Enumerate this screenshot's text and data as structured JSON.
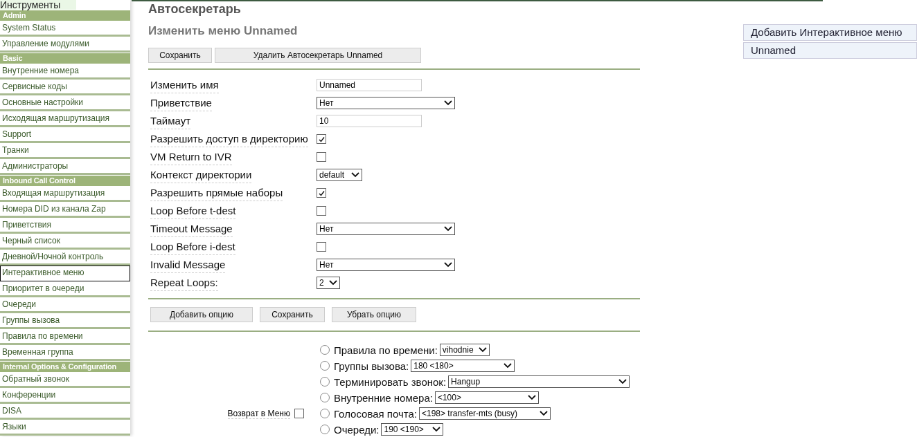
{
  "sidebar": {
    "tab": "Инструменты",
    "sections": [
      {
        "title": "Admin",
        "items": [
          {
            "label": "System Status",
            "selected": false
          },
          {
            "label": "Управление модулями",
            "selected": false
          }
        ]
      },
      {
        "title": "Basic",
        "items": [
          {
            "label": "Внутренние номера",
            "selected": false
          },
          {
            "label": "Сервисные коды",
            "selected": false
          },
          {
            "label": "Основные настройки",
            "selected": false
          },
          {
            "label": "Исходящая маршрутизация",
            "selected": false
          },
          {
            "label": "Support",
            "selected": false
          },
          {
            "label": "Транки",
            "selected": false
          },
          {
            "label": "Администраторы",
            "selected": false
          }
        ]
      },
      {
        "title": "Inbound Call Control",
        "items": [
          {
            "label": "Входящая маршрутизация",
            "selected": false
          },
          {
            "label": "Номера DID из канала Zap",
            "selected": false
          },
          {
            "label": "Приветствия",
            "selected": false
          },
          {
            "label": "Черный список",
            "selected": false
          },
          {
            "label": "Дневной/Ночной контроль",
            "selected": false
          },
          {
            "label": "Интерактивное меню",
            "selected": true
          },
          {
            "label": "Приоритет в очереди",
            "selected": false
          },
          {
            "label": "Очереди",
            "selected": false
          },
          {
            "label": "Группы вызова",
            "selected": false
          },
          {
            "label": "Правила по времени",
            "selected": false
          },
          {
            "label": "Временная группа",
            "selected": false
          }
        ]
      },
      {
        "title": "Internal Options & Configuration",
        "items": [
          {
            "label": "Обратный звонок",
            "selected": false
          },
          {
            "label": "Конференции",
            "selected": false
          },
          {
            "label": "DISA",
            "selected": false
          },
          {
            "label": "Языки",
            "selected": false
          }
        ]
      }
    ]
  },
  "page_title": "Автосекретарь",
  "subtitle": "Изменить меню Unnamed",
  "top_buttons": [
    "Сохранить",
    "Удалить Автосекретарь Unnamed"
  ],
  "fields": [
    {
      "label": "Изменить имя",
      "kind": "text",
      "value": "Unnamed"
    },
    {
      "label": "Приветствие",
      "kind": "select",
      "value": "Нет"
    },
    {
      "label": "Таймаут",
      "kind": "text",
      "value": "10"
    },
    {
      "label": "Разрешить доступ в директорию",
      "kind": "checkbox",
      "checked": true
    },
    {
      "label": "VM Return to IVR",
      "kind": "checkbox",
      "checked": false
    },
    {
      "label": "Контекст директории",
      "kind": "select",
      "value": "default"
    },
    {
      "label": "Разрешить прямые наборы",
      "kind": "checkbox",
      "checked": true
    },
    {
      "label": "Loop Before t-dest",
      "kind": "checkbox",
      "checked": false
    },
    {
      "label": "Timeout Message",
      "kind": "select",
      "value": "Нет"
    },
    {
      "label": "Loop Before i-dest",
      "kind": "checkbox",
      "checked": false
    },
    {
      "label": "Invalid Message",
      "kind": "select",
      "value": "Нет"
    },
    {
      "label": "Repeat Loops:",
      "kind": "select",
      "value": "2"
    }
  ],
  "option_buttons": [
    "Добавить опцию",
    "Сохранить",
    "Убрать опцию"
  ],
  "return_to_menu": {
    "label": "Возврат в Меню",
    "checked": false
  },
  "destinations": [
    {
      "label": "Правила по времени:",
      "value": "vihodnie",
      "selected": false
    },
    {
      "label": "Группы вызова:",
      "value": "180 <180>",
      "selected": false
    },
    {
      "label": "Терминировать звонок:",
      "value": "Hangup",
      "selected": false
    },
    {
      "label": "Внутренние номера:",
      "value": "<100>",
      "selected": false
    },
    {
      "label": "Голосовая почта:",
      "value": "<198> transfer-mts (busy)",
      "selected": false
    },
    {
      "label": "Очереди:",
      "value": "190 <190>",
      "selected": false
    }
  ],
  "right_menu": [
    {
      "label": "Добавить Интерактивное меню",
      "selected": false
    },
    {
      "label": "Unnamed",
      "selected": false
    }
  ]
}
